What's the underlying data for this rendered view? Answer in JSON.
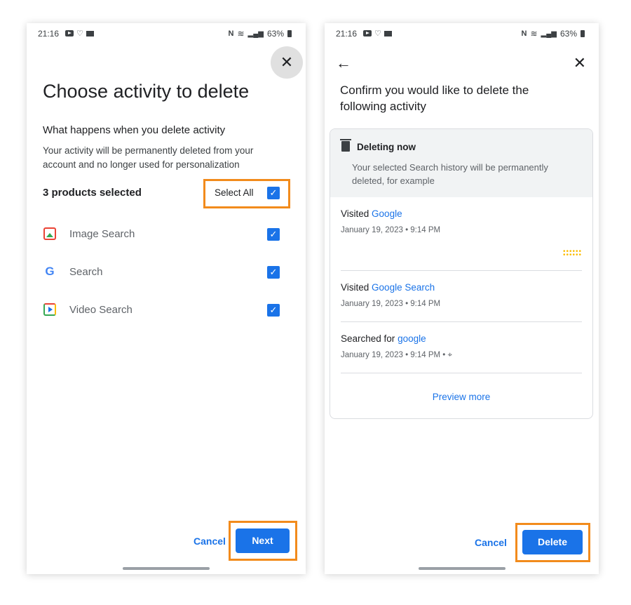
{
  "status_bar": {
    "time": "21:16",
    "battery": "63%"
  },
  "screen1": {
    "title": "Choose activity to delete",
    "subtitle": "What happens when you delete activity",
    "description": "Your activity will be permanently deleted from your account and no longer used for personalization",
    "selected_count": "3 products selected",
    "select_all_label": "Select All",
    "products": [
      {
        "label": "Image Search",
        "icon": "image-search-icon",
        "checked": true
      },
      {
        "label": "Search",
        "icon": "google-g-icon",
        "checked": true
      },
      {
        "label": "Video Search",
        "icon": "video-search-icon",
        "checked": true
      }
    ],
    "cancel_label": "Cancel",
    "next_label": "Next"
  },
  "screen2": {
    "title": "Confirm you would like to delete the following activity",
    "card": {
      "heading": "Deleting now",
      "description": "Your selected Search history will be permanently deleted, for example",
      "items": [
        {
          "prefix": "Visited",
          "link": "Google",
          "date": "January 19, 2023 • 9:14 PM"
        },
        {
          "prefix": "Visited",
          "link": "Google Search",
          "date": "January 19, 2023 • 9:14 PM"
        },
        {
          "prefix": "Searched for",
          "link": "google",
          "date": "January 19, 2023 • 9:14 PM •"
        }
      ],
      "preview_more": "Preview more"
    },
    "cancel_label": "Cancel",
    "delete_label": "Delete"
  },
  "colors": {
    "accent": "#1a73e8",
    "highlight": "#f28b1c"
  }
}
